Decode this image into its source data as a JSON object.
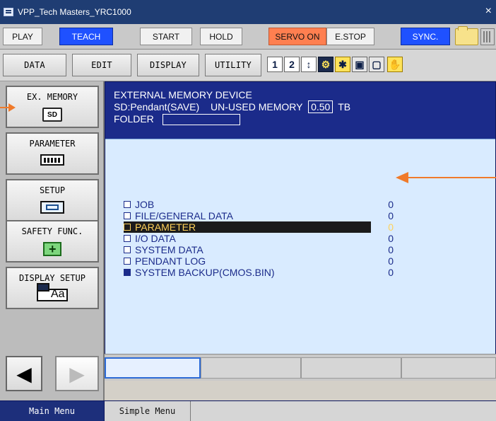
{
  "window": {
    "title": "VPP_Tech Masters_YRC1000",
    "close_label": "×"
  },
  "top_row": {
    "play": "PLAY",
    "teach": "TEACH",
    "start": "START",
    "hold": "HOLD",
    "servo_on": "SERVO ON",
    "estop": "E.STOP",
    "sync": "SYNC."
  },
  "menu_row": {
    "data": "DATA",
    "edit": "EDIT",
    "display": "DISPLAY",
    "utility": "UTILITY"
  },
  "left_panel": {
    "ex_memory": "EX. MEMORY",
    "parameter": "PARAMETER",
    "setup": "SETUP",
    "safety_func": "SAFETY FUNC.",
    "display_setup": "DISPLAY SETUP",
    "sd_label": "SD"
  },
  "main_panel": {
    "line1": "EXTERNAL MEMORY DEVICE",
    "line2_prefix": "SD:Pendant(SAVE)",
    "unused_label": "UN-USED MEMORY",
    "unused_value": "0.50",
    "unused_unit": "TB",
    "folder_label": "FOLDER",
    "items": [
      {
        "label": "JOB",
        "count": "0",
        "selected": false,
        "filled": false
      },
      {
        "label": "FILE/GENERAL DATA",
        "count": "0",
        "selected": false,
        "filled": false
      },
      {
        "label": "PARAMETER",
        "count": "0",
        "selected": true,
        "filled": false
      },
      {
        "label": "I/O DATA",
        "count": "0",
        "selected": false,
        "filled": false
      },
      {
        "label": "SYSTEM DATA",
        "count": "0",
        "selected": false,
        "filled": false
      },
      {
        "label": "PENDANT LOG",
        "count": "0",
        "selected": false,
        "filled": false
      },
      {
        "label": "SYSTEM BACKUP(CMOS.BIN)",
        "count": "0",
        "selected": false,
        "filled": true
      }
    ]
  },
  "bottom_menu": {
    "main_menu": "Main Menu",
    "simple_menu": "Simple Menu"
  },
  "colors": {
    "title_bar": "#1f3d73",
    "accent_blue": "#1f51ff",
    "servo_orange": "#ff7f50",
    "panel_blue": "#1b2b8a",
    "list_bg": "#d9ebff",
    "highlight_text": "#ffd25a",
    "annotation_arrow": "#f07a2a"
  },
  "icons": {
    "window_icon": "app-icon",
    "folder": "folder-icon",
    "calculator": "calculator-icon",
    "left_nav": "left-arrow-icon",
    "right_nav": "right-arrow-icon"
  }
}
